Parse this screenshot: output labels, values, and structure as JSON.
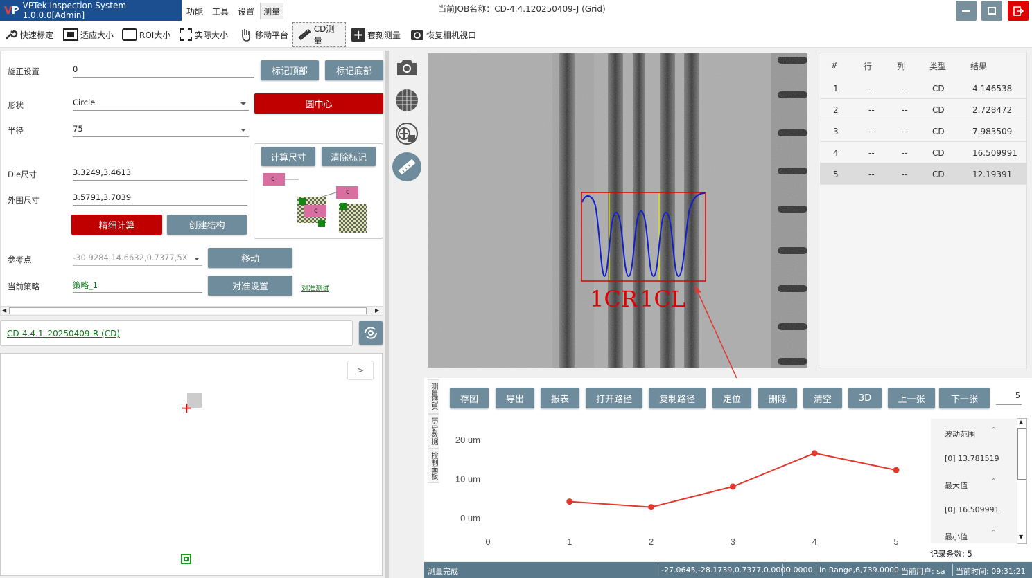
{
  "app": {
    "title": "VPTek Inspection System 1.0.0.0[Admin]",
    "logo_text": "VP"
  },
  "menu": [
    {
      "label": "功能"
    },
    {
      "label": "工具"
    },
    {
      "label": "设置"
    },
    {
      "label": "测量"
    }
  ],
  "job": {
    "label": "当前JOB名称：CD-4.4.120250409-J (Grid)"
  },
  "toolbar": {
    "quick_calib": "快速标定",
    "fit_size": "适应大小",
    "roi_size": "ROI大小",
    "actual_size": "实际大小",
    "move_stage": "移动平台",
    "cd_measure": "CD测量",
    "overlay_measure": "套刻测量",
    "restore_view": "恢复相机视口"
  },
  "form": {
    "rotate_label": "旋正设置",
    "rotate_value": "0",
    "shape_label": "形状",
    "shape_value": "Circle",
    "radius_label": "半径",
    "radius_value": "75",
    "die_label": "Die尺寸",
    "die_value": "3.3249,3.4613",
    "outer_label": "外围尺寸",
    "outer_value": "3.5791,3.7039",
    "ref_label": "参考点",
    "ref_value": "-30.9284,14.6632,0.7377,5X",
    "strategy_label": "当前策略",
    "strategy_value": "策略_1",
    "align_test": "对准测试"
  },
  "buttons": {
    "mark_top": "标记顶部",
    "mark_bottom": "标记底部",
    "circle_center": "圆中心",
    "calc_size": "计算尺寸",
    "clear_mark": "清除标记",
    "fine_calc": "精细计算",
    "create_struct": "创建结构",
    "move": "移动",
    "align_settings": "对准设置",
    "expand": ">"
  },
  "diagram": {
    "c": "c"
  },
  "recipe": {
    "name": "CD-4.4.1_20250409-R (CD)"
  },
  "image": {
    "label_left": "1CR",
    "label_right": "1CL"
  },
  "results": {
    "headers": [
      "#",
      "行",
      "列",
      "类型",
      "结果"
    ],
    "rows": [
      {
        "n": "1",
        "row": "--",
        "col": "--",
        "type": "CD",
        "result": "4.146538"
      },
      {
        "n": "2",
        "row": "--",
        "col": "--",
        "type": "CD",
        "result": "2.728472"
      },
      {
        "n": "3",
        "row": "--",
        "col": "--",
        "type": "CD",
        "result": "7.983509"
      },
      {
        "n": "4",
        "row": "--",
        "col": "--",
        "type": "CD",
        "result": "16.509991"
      },
      {
        "n": "5",
        "row": "--",
        "col": "--",
        "type": "CD",
        "result": "12.19391"
      }
    ],
    "selected_index": 4
  },
  "side_tabs": {
    "results": "测量结果",
    "history": "历史数据",
    "control": "控制面板"
  },
  "bottom_buttons": [
    "存图",
    "导出",
    "报表",
    "打开路径",
    "复制路径",
    "定位",
    "删除",
    "清空",
    "3D",
    "上一张",
    "下一张"
  ],
  "page_input": "5",
  "chart_data": {
    "type": "line",
    "x": [
      1,
      2,
      3,
      4,
      5
    ],
    "values": [
      4.146538,
      2.728472,
      7.983509,
      16.509991,
      12.19391
    ],
    "x_ticks": [
      "0",
      "1",
      "2",
      "3",
      "4",
      "5"
    ],
    "y_ticks": [
      "0 um",
      "10 um",
      "20 um"
    ],
    "xlim": [
      0,
      5
    ],
    "ylim": [
      0,
      20
    ],
    "color": "#e03a2f",
    "grid": false
  },
  "stats": {
    "range_label": "波动范围",
    "range_value": "[0]  13.781519",
    "max_label": "最大值",
    "max_value": "[0]  16.509991",
    "min_label": "最小值",
    "records": "记录条数: 5"
  },
  "status": {
    "text": "测量完成",
    "coords": "-27.0645,-28.1739,0.7377,0.0000",
    "val": "0.0000",
    "range": "In Range,6,739.0000",
    "user": "当前用户:  sa",
    "time": "当前时间:  09:31:21"
  },
  "colors": {
    "accent": "#6f8c9c",
    "danger": "#c00000",
    "title_bg": "#1b4f8f",
    "green": "#0a7a16"
  }
}
